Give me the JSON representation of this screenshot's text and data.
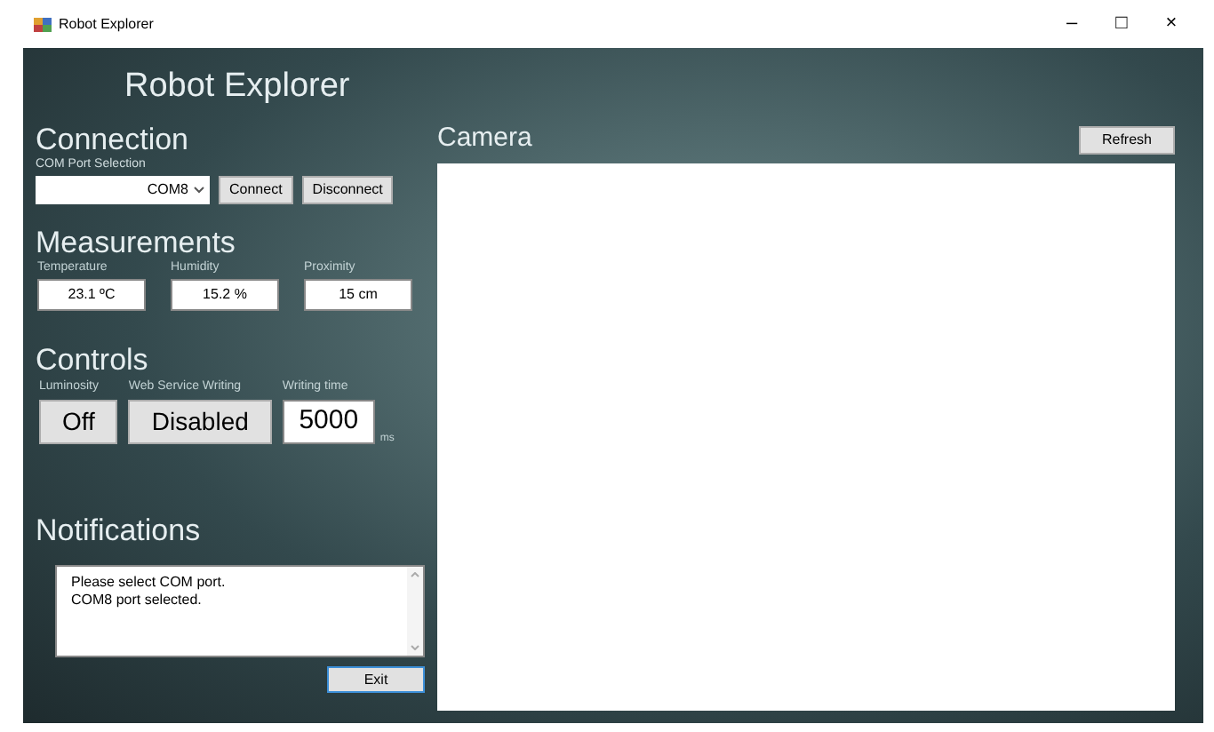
{
  "window": {
    "title": "Robot Explorer",
    "controls": [
      "–",
      "□",
      "×"
    ]
  },
  "app_title": "Robot Explorer",
  "connection": {
    "heading": "Connection",
    "port_label": "COM Port Selection",
    "port_value": "COM8",
    "buttons": [
      "Connect",
      "Disconnect"
    ]
  },
  "measurements": {
    "heading": "Measurements",
    "fields": [
      {
        "label": "Temperature",
        "value": "23.1 ºC"
      },
      {
        "label": "Humidity",
        "value": "15.2 %"
      },
      {
        "label": "Proximity",
        "value": "15 cm"
      }
    ]
  },
  "controls": {
    "heading": "Controls",
    "items": [
      {
        "kind": "button",
        "label": "Luminosity",
        "value": "Off"
      },
      {
        "kind": "button",
        "label": "Web Service Writing",
        "value": "Disabled"
      },
      {
        "kind": "input",
        "label": "Writing time",
        "value": "5000",
        "unit": "ms"
      }
    ]
  },
  "notifications": {
    "heading": "Notifications",
    "lines": [
      "Please select COM port.",
      "COM8 port selected."
    ]
  },
  "exit_button": "Exit",
  "camera": {
    "heading": "Camera",
    "refresh_button": "Refresh"
  }
}
